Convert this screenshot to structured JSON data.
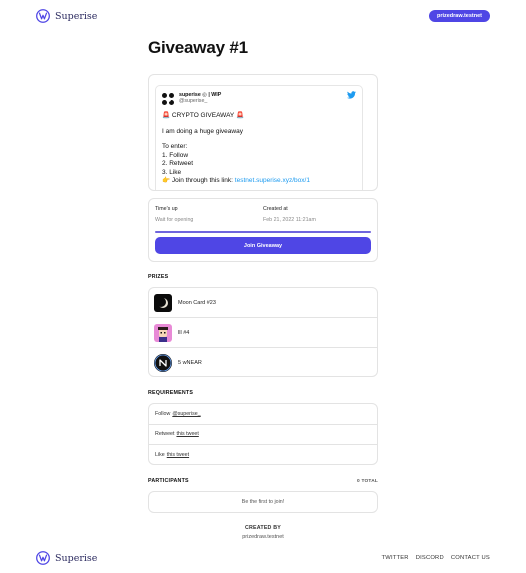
{
  "header": {
    "brand": "Superise",
    "account": "prizedraw.testnet"
  },
  "page": {
    "title": "Giveaway #1"
  },
  "tweet": {
    "name": "superise ◎ | WIP",
    "handle": "@superise_",
    "line1": "🚨 CRYPTO GIVEAWAY 🚨",
    "line2": "I am doing a huge giveaway",
    "line3": "To enter:",
    "step1": "1. Follow",
    "step2": "2. Retweet",
    "step3": "3. Like",
    "step4_prefix": "👉 Join through this link:",
    "step4_link": "testnet.superise.xyz/box/1"
  },
  "status": {
    "left_label": "Time's up",
    "left_value": "Wait for opening",
    "right_label": "Created at",
    "right_value": "Feb 21, 2022 11:21am",
    "progress": 1.0,
    "join_label": "Join Giveaway"
  },
  "prizes": {
    "label": "PRIZES",
    "items": [
      {
        "name": "Moon Card #23",
        "icon": "moon-card-thumbnail"
      },
      {
        "name": "lll #4",
        "icon": "nft-character-thumbnail"
      },
      {
        "name": "5 wNEAR",
        "icon": "near-token-icon"
      }
    ]
  },
  "requirements": {
    "label": "REQUIREMENTS",
    "items": [
      {
        "prefix": "Follow",
        "link": "@superise_"
      },
      {
        "prefix": "Retweet",
        "link": "this tweet"
      },
      {
        "prefix": "Like",
        "link": "this tweet"
      }
    ]
  },
  "participants": {
    "label": "PARTICIPANTS",
    "count": "0 TOTAL",
    "empty": "Be the first to join!"
  },
  "created_by": {
    "label": "CREATED BY",
    "value": "prizedraw.testnet"
  },
  "footer": {
    "brand": "Superise",
    "links": [
      "TWITTER",
      "DISCORD",
      "CONTACT US"
    ]
  },
  "colors": {
    "accent": "#4f46e5",
    "brand_text": "#2b2a5f",
    "twitter": "#1d9bf0"
  }
}
